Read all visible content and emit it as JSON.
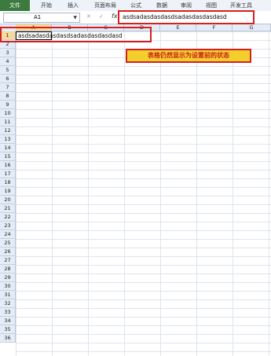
{
  "ribbon": {
    "tabs": [
      "文件",
      "开始",
      "插入",
      "页面布局",
      "公式",
      "数据",
      "审阅",
      "视图",
      "开发工具"
    ]
  },
  "formula_bar": {
    "name_box": "A1",
    "fx_label": "fx",
    "content": "asdsadasdasdasdsadasdasdasdasd"
  },
  "sheet": {
    "columns": [
      "A",
      "B",
      "C",
      "D",
      "E",
      "F",
      "G"
    ],
    "rows": [
      "1",
      "2",
      "3",
      "4",
      "5",
      "6",
      "7",
      "8",
      "9",
      "10",
      "11",
      "12",
      "13",
      "14",
      "15",
      "16",
      "17",
      "18",
      "19",
      "20",
      "21",
      "22",
      "23",
      "24",
      "25",
      "26",
      "27",
      "28",
      "29",
      "30",
      "31",
      "32",
      "33",
      "34",
      "35",
      "36"
    ],
    "cell_a1": "asdsadasdasdasdsadasdasdasdasd"
  },
  "annotation": {
    "callout_text": "表格仍然显示为设置前的状态"
  },
  "colors": {
    "highlight_red": "#d62020",
    "callout_yellow": "#f2cf2c",
    "file_tab_green": "#3d7a3d",
    "header_selected": "#f9d99a"
  }
}
